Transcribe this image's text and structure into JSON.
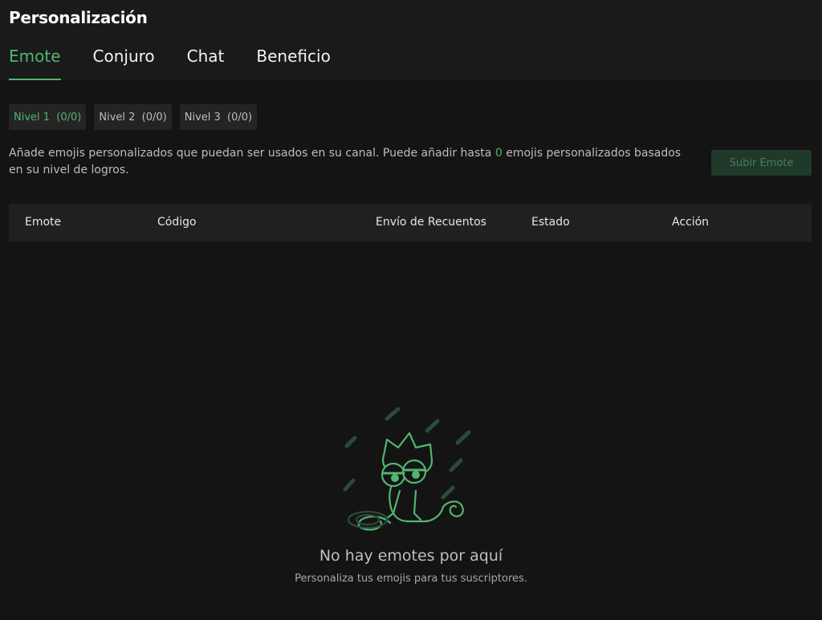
{
  "header": {
    "title": "Personalización"
  },
  "tabs": [
    {
      "label": "Emote"
    },
    {
      "label": "Conjuro"
    },
    {
      "label": "Chat"
    },
    {
      "label": "Beneficio"
    }
  ],
  "levels": [
    {
      "label": "Nivel 1  (0/0)"
    },
    {
      "label": "Nivel 2  (0/0)"
    },
    {
      "label": "Nivel 3  (0/0)"
    }
  ],
  "description": {
    "before": "Añade emojis personalizados que puedan ser usados en su canal. Puede añadir hasta ",
    "count": "0",
    "after": " emojis personalizados basados en su nivel de logros."
  },
  "upload_button": {
    "label": "Subir Emote"
  },
  "table": {
    "columns": [
      "Emote",
      "Código",
      "Envío de Recuentos",
      "Estado",
      "Acción"
    ]
  },
  "empty_state": {
    "title": "No hay emotes por aquí",
    "subtitle": "Personaliza tus emojis para tus suscriptores.",
    "illustration": "sleepy-chameleon-in-rain",
    "accent_color": "#53b46f"
  },
  "colors": {
    "accent": "#53b46f",
    "background": "#141414",
    "header": "#1a1a1a"
  }
}
